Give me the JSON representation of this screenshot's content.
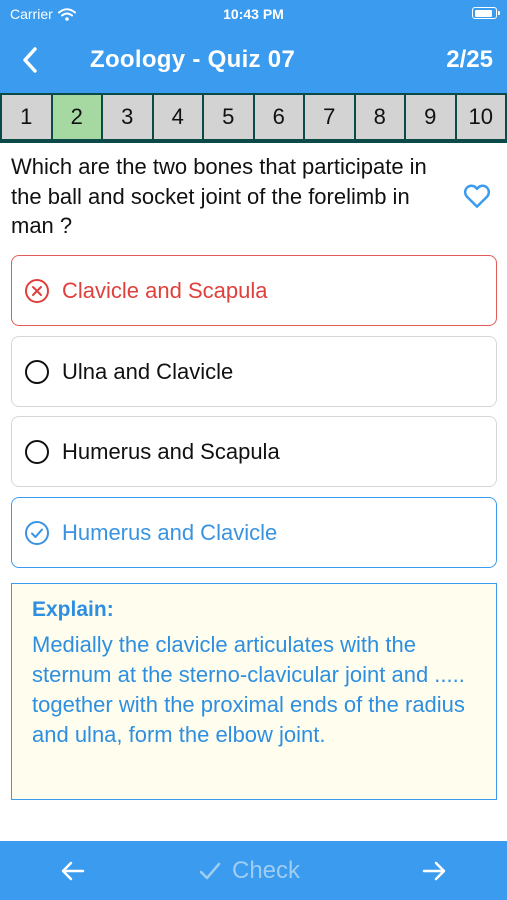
{
  "status_bar": {
    "carrier": "Carrier",
    "time": "10:43 PM",
    "battery_level": 0.9
  },
  "nav": {
    "title": "Zoology - Quiz 07",
    "progress": "2/25"
  },
  "question_nav": [
    "1",
    "2",
    "3",
    "4",
    "5",
    "6",
    "7",
    "8",
    "9",
    "10"
  ],
  "current_question": "2",
  "question": {
    "text": "Which are the two bones that participate in the ball and socket joint of the forelimb in man ?",
    "favorite": false
  },
  "options": [
    {
      "label": "Clavicle and Scapula",
      "state": "wrong"
    },
    {
      "label": "Ulna and Clavicle",
      "state": "neutral"
    },
    {
      "label": "Humerus and Scapula",
      "state": "neutral"
    },
    {
      "label": "Humerus and Clavicle",
      "state": "correct"
    }
  ],
  "explain": {
    "title": "Explain:",
    "body": "Medially the clavicle articulates with the sternum at the sterno-clavicular joint and ..... together with the proximal ends of the radius and ulna, form the elbow joint."
  },
  "footer": {
    "check_label": "Check",
    "check_enabled": false
  },
  "colors": {
    "primary": "#3a9bef",
    "current_question": "#a6d8a2",
    "wrong": "#e0403c",
    "correct": "#3a93e0",
    "explain_bg": "#fffdee",
    "check_disabled": "#9fcdf2"
  },
  "icons": {
    "wifi": "wifi-icon",
    "battery": "battery-icon",
    "back": "chevron-left-icon",
    "favorite": "heart-outline-icon",
    "wrong": "x-circle-icon",
    "neutral": "radio-empty-icon",
    "correct": "check-circle-icon",
    "prev": "arrow-left-icon",
    "check": "checkmark-icon",
    "next": "arrow-right-icon"
  }
}
